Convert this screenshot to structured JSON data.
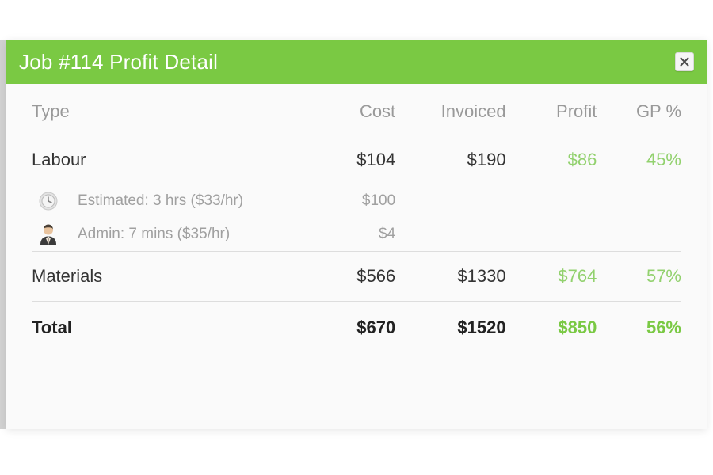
{
  "dialog": {
    "title": "Job #114 Profit Detail",
    "close_label": "×",
    "accent_color": "#7ac943",
    "body_background": "#fafafa",
    "profit_color": "#92d16e",
    "total_profit_color": "#7ac944"
  },
  "table": {
    "headers": {
      "type": "Type",
      "cost": "Cost",
      "invoiced": "Invoiced",
      "profit": "Profit",
      "gp": "GP %"
    },
    "rows": [
      {
        "kind": "main",
        "type": "Labour",
        "cost": "$104",
        "invoiced": "$190",
        "profit": "$86",
        "gp": "45%"
      },
      {
        "kind": "sub",
        "icon": "clock-icon",
        "type": "Estimated: 3 hrs ($33/hr)",
        "cost": "$100",
        "invoiced": "",
        "profit": "",
        "gp": ""
      },
      {
        "kind": "sub",
        "icon": "admin-user-icon",
        "type": "Admin: 7 mins ($35/hr)",
        "cost": "$4",
        "invoiced": "",
        "profit": "",
        "gp": ""
      },
      {
        "kind": "main",
        "type": "Materials",
        "cost": "$566",
        "invoiced": "$1330",
        "profit": "$764",
        "gp": "57%"
      },
      {
        "kind": "total",
        "type": "Total",
        "cost": "$670",
        "invoiced": "$1520",
        "profit": "$850",
        "gp": "56%"
      }
    ]
  }
}
